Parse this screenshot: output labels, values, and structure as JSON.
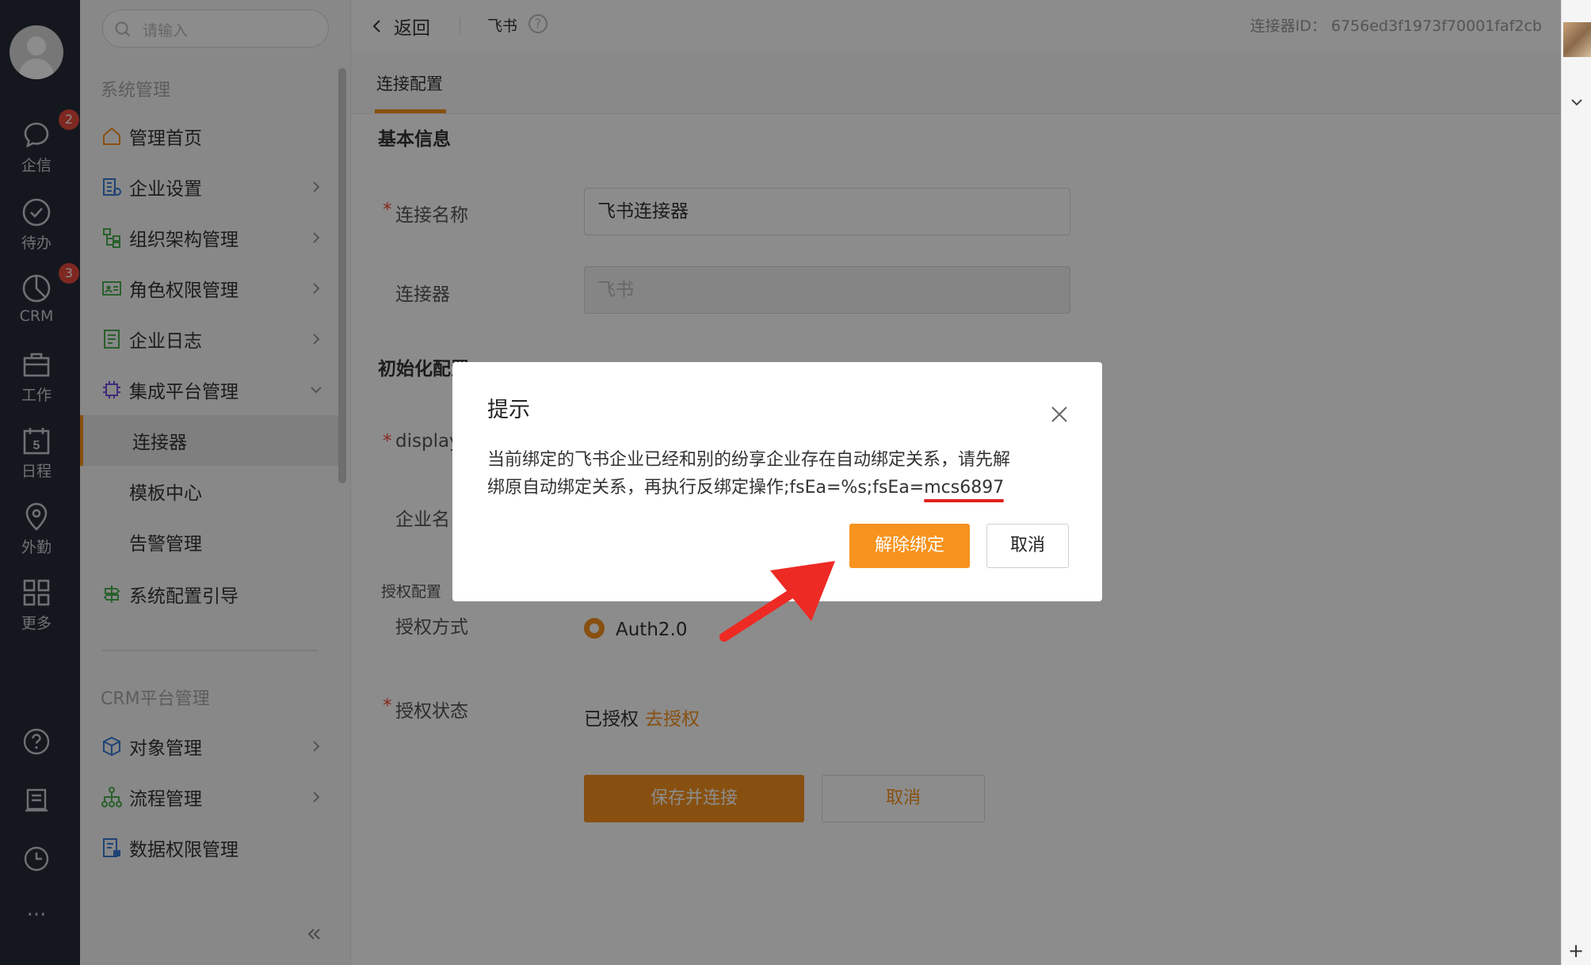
{
  "rail": {
    "items": [
      {
        "label": "企信",
        "badge": "2",
        "icon": "chat-icon"
      },
      {
        "label": "待办",
        "badge": "",
        "icon": "check-circle-icon"
      },
      {
        "label": "CRM",
        "badge": "3",
        "icon": "pie-icon"
      },
      {
        "label": "工作",
        "badge": "",
        "icon": "briefcase-icon"
      },
      {
        "label": "日程",
        "badge": "",
        "icon": "calendar-icon",
        "day": "5"
      },
      {
        "label": "外勤",
        "badge": "",
        "icon": "location-icon"
      },
      {
        "label": "更多",
        "badge": "",
        "icon": "grid-icon"
      }
    ],
    "bottom_icons": [
      "help-icon",
      "document-icon",
      "clock-icon",
      "more-icon"
    ],
    "more_label": "···"
  },
  "sidebar": {
    "search_placeholder": "请输入",
    "section_system": "系统管理",
    "section_crm": "CRM平台管理",
    "items": [
      {
        "label": "管理首页",
        "icon": "home-icon",
        "arrow": false
      },
      {
        "label": "企业设置",
        "icon": "building-icon",
        "arrow": true
      },
      {
        "label": "组织架构管理",
        "icon": "org-icon",
        "arrow": true
      },
      {
        "label": "角色权限管理",
        "icon": "id-card-icon",
        "arrow": true
      },
      {
        "label": "企业日志",
        "icon": "log-icon",
        "arrow": true
      },
      {
        "label": "集成平台管理",
        "icon": "chip-icon",
        "arrow": "down"
      }
    ],
    "sub_items": [
      "连接器",
      "模板中心",
      "告警管理"
    ],
    "items_after": [
      {
        "label": "系统配置引导",
        "icon": "signpost-icon"
      }
    ],
    "crm_items": [
      {
        "label": "对象管理",
        "icon": "cube-icon"
      },
      {
        "label": "流程管理",
        "icon": "flow-icon"
      },
      {
        "label": "数据权限管理",
        "icon": "data-lock-icon"
      }
    ],
    "collapse_label": "«"
  },
  "topbar": {
    "back_label": "返回",
    "crumb": "飞书",
    "help": "?",
    "connector_id": "连接器ID： 6756ed3f1973f70001faf2cb"
  },
  "tabs": {
    "active": "连接配置"
  },
  "form": {
    "section_basic": "基本信息",
    "name_label": "连接名称",
    "name_value": "飞书连接器",
    "connector_label": "连接器",
    "connector_value": "飞书",
    "section_init": "初始化配置",
    "display_label": "display",
    "company_label": "企业名",
    "auth_config_label": "授权配置",
    "auth_method_label": "授权方式",
    "auth_method_value": "Auth2.0",
    "auth_status_label": "授权状态",
    "auth_status_value": "已授权",
    "auth_link": "去授权",
    "save_label": "保存并连接",
    "cancel_label": "取消",
    "required_mark": "*"
  },
  "modal": {
    "title": "提示",
    "message_line1": "当前绑定的飞书企业已经和别的纷享企业存在自动绑定关系，请先解",
    "message_line2_prefix": "绑原自动绑定关系，再执行反绑定操作;fsEa=%s;fsEa=",
    "message_highlight": "mcs6897",
    "unbind_label": "解除绑定",
    "cancel_label": "取消"
  },
  "right_strip": {
    "plus": "+"
  },
  "colors": {
    "accent": "#f7931e",
    "rail_bg": "#262c38",
    "badge": "#e64a3c",
    "annotation_red": "#e02020"
  }
}
